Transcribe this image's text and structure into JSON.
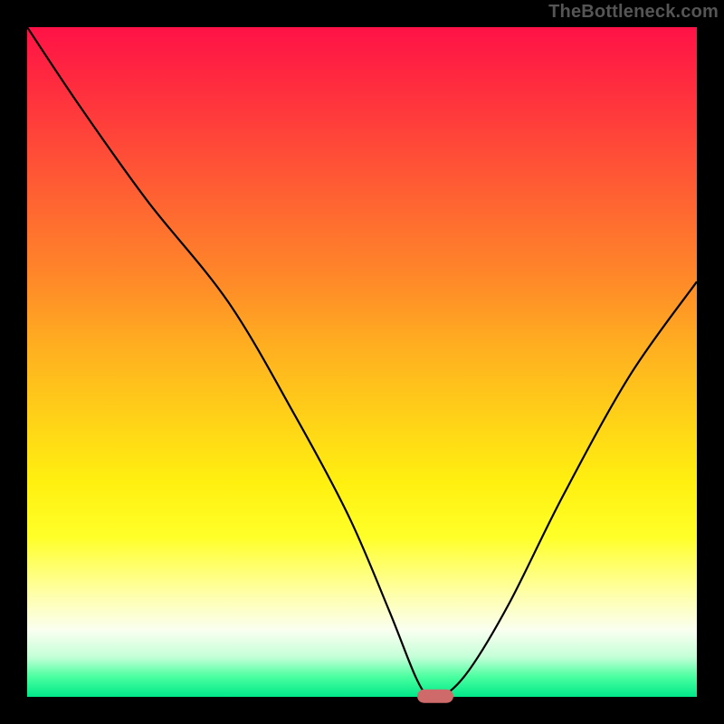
{
  "watermark": "TheBottleneck.com",
  "colors": {
    "marker": "#cf6a6a",
    "curve": "#000000",
    "frame": "#000000"
  },
  "chart_data": {
    "type": "line",
    "title": "",
    "xlabel": "",
    "ylabel": "",
    "xlim": [
      0,
      100
    ],
    "ylim": [
      0,
      100
    ],
    "grid": false,
    "legend": false,
    "series": [
      {
        "name": "bottleneck-curve",
        "x": [
          0,
          8,
          18,
          30,
          40,
          48,
          54,
          58,
          60,
          62,
          66,
          72,
          80,
          90,
          100
        ],
        "values": [
          100,
          88,
          74,
          59,
          42,
          27,
          13,
          3,
          0,
          0,
          4,
          14,
          30,
          48,
          62
        ]
      }
    ],
    "marker": {
      "x": 61,
      "y": 0
    }
  }
}
